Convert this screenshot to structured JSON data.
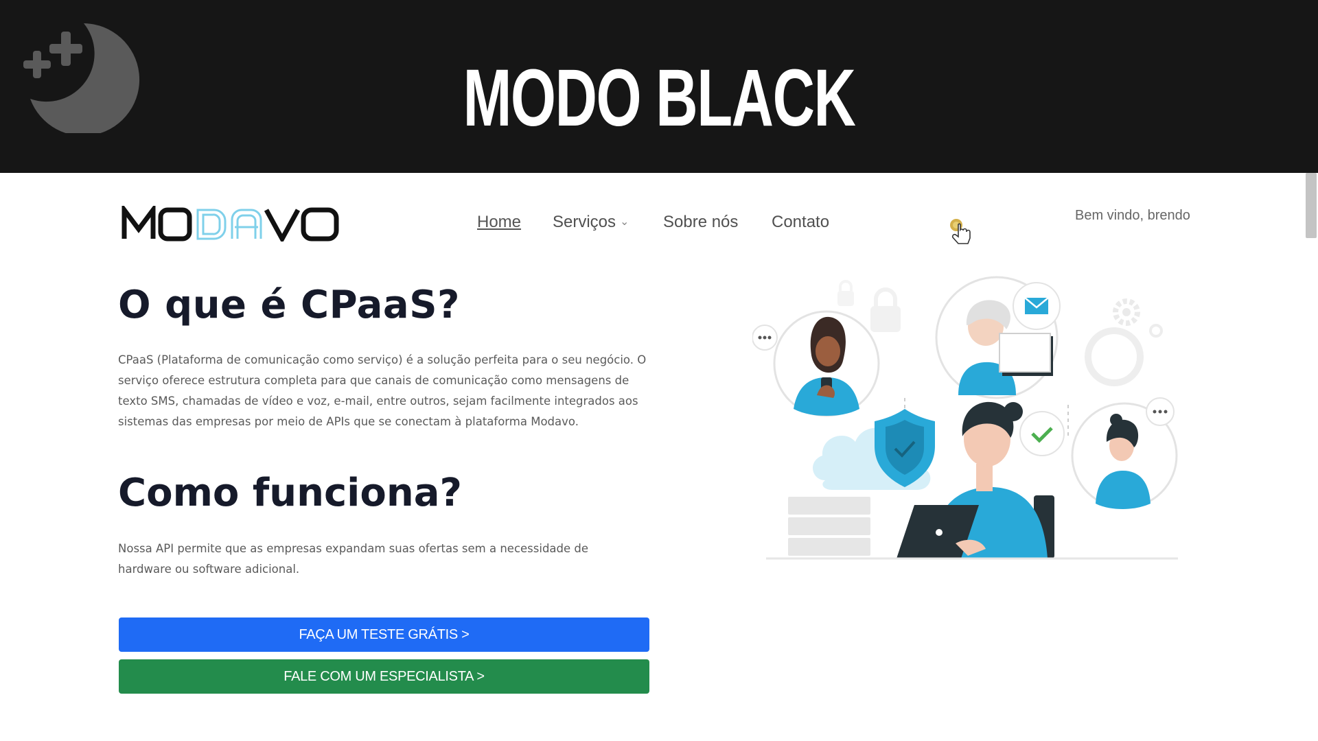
{
  "banner": {
    "title": "MODO BLACK",
    "icon": "moon-stars-icon",
    "background": "#161616",
    "title_color": "#ffffff"
  },
  "header": {
    "logo": "MODAVO",
    "nav": [
      {
        "label": "Home",
        "active": true
      },
      {
        "label": "Serviços",
        "has_dropdown": true
      },
      {
        "label": "Sobre nós"
      },
      {
        "label": "Contato"
      }
    ],
    "theme_toggle_icon": "sun-icon",
    "cursor_icon": "hand-pointer-icon",
    "welcome": "Bem vindo, brendo"
  },
  "main": {
    "section1": {
      "title": "O que é CPaaS?",
      "text": "CPaaS (Plataforma de comunicação como serviço) é a solução perfeita para o seu negócio. O serviço oferece estrutura completa para que canais de comunicação como mensagens de texto SMS, chamadas de vídeo e voz, e-mail, entre outros, sejam facilmente integrados aos sistemas das empresas por meio de APIs que se conectam à plataforma Modavo."
    },
    "section2": {
      "title": "Como funciona?",
      "text": "Nossa API permite que as empresas expandam suas ofertas sem a necessidade de hardware ou software adicional."
    },
    "buttons": {
      "trial": "FAÇA UM TESTE GRÁTIS >",
      "specialist": "FALE COM UM ESPECIALISTA >"
    }
  },
  "colors": {
    "primary_blue": "#1f6bf5",
    "success_green": "#238c4c",
    "heading": "#161a2a",
    "illustration_accent": "#29a9d8"
  }
}
